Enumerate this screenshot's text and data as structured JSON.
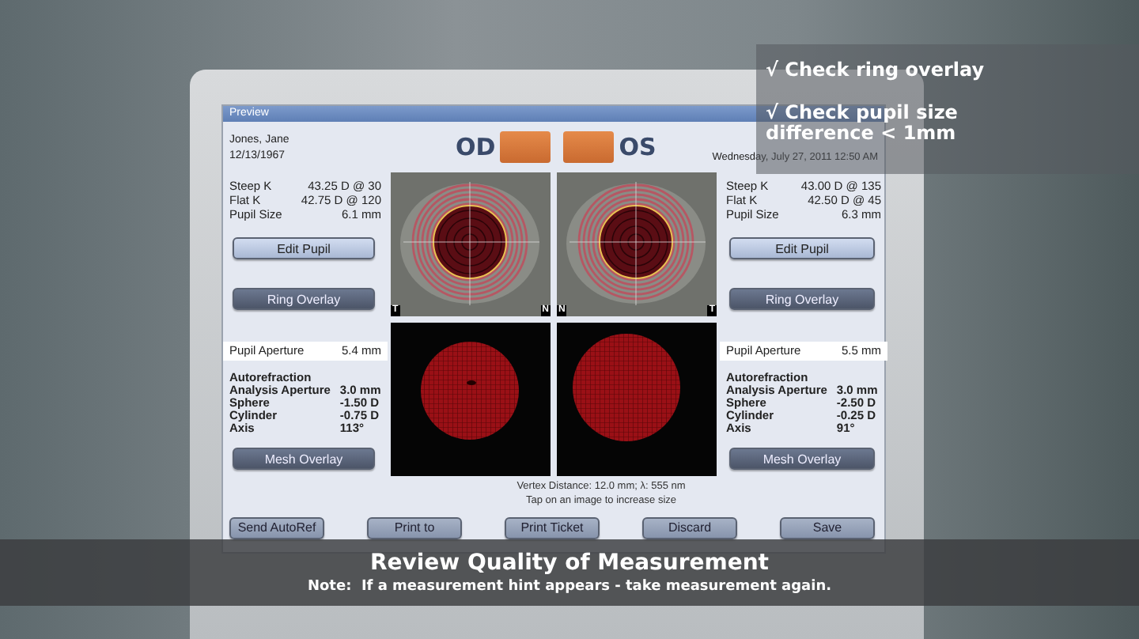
{
  "window": {
    "title": "Preview"
  },
  "patient": {
    "name": "Jones, Jane",
    "dob": "12/13/1967"
  },
  "eyes": [
    {
      "label": "OD"
    },
    {
      "label": "OS"
    }
  ],
  "date": "Wednesday, July 27, 2011 12:50 AM",
  "panels": [
    {
      "keratometry": [
        {
          "label": "Steep K",
          "value": "43.25 D @ 30"
        },
        {
          "label": "Flat K",
          "value": "42.75 D @ 120"
        },
        {
          "label": "Pupil Size",
          "value": "6.1 mm"
        }
      ],
      "buttons": [
        {
          "label": "Edit Pupil",
          "on": false
        },
        {
          "label": "Ring Overlay",
          "on": true
        }
      ],
      "aperture": {
        "label": "Pupil Aperture",
        "value": "5.4 mm"
      },
      "autorefraction": {
        "title": "Autorefraction",
        "rows": [
          {
            "label": "Analysis Aperture",
            "value": "3.0 mm"
          },
          {
            "label": "Sphere",
            "value": "-1.50 D"
          },
          {
            "label": "Cylinder",
            "value": "-0.75 D"
          },
          {
            "label": "Axis",
            "value": "113°"
          }
        ]
      },
      "mesh_button": {
        "label": "Mesh Overlay",
        "on": true
      }
    },
    {
      "keratometry": [
        {
          "label": "Steep K",
          "value": "43.00 D @ 135"
        },
        {
          "label": "Flat K",
          "value": "42.50 D @ 45"
        },
        {
          "label": "Pupil Size",
          "value": "6.3 mm"
        }
      ],
      "buttons": [
        {
          "label": "Edit Pupil",
          "on": false
        },
        {
          "label": "Ring Overlay",
          "on": true
        }
      ],
      "aperture": {
        "label": "Pupil Aperture",
        "value": "5.5 mm"
      },
      "autorefraction": {
        "title": "Autorefraction",
        "rows": [
          {
            "label": "Analysis Aperture",
            "value": "3.0 mm"
          },
          {
            "label": "Sphere",
            "value": "-2.50 D"
          },
          {
            "label": "Cylinder",
            "value": "-0.25 D"
          },
          {
            "label": "Axis",
            "value": "91°"
          }
        ]
      },
      "mesh_button": {
        "label": "Mesh Overlay",
        "on": true
      }
    }
  ],
  "topography": [
    {
      "corner_left": "T",
      "corner_right": "N"
    },
    {
      "corner_left": "N",
      "corner_right": "T"
    }
  ],
  "footer": {
    "vertex": "Vertex Distance: 12.0 mm; λ: 555 nm",
    "hint": "Tap on an image to increase size"
  },
  "actions": [
    "Send AutoRef",
    "Print to",
    "Print Ticket",
    "Discard",
    "Save"
  ],
  "checklist": [
    "√ Check ring overlay",
    "√ Check pupil size difference < 1mm"
  ],
  "caption": {
    "title": "Review Quality of Measurement",
    "note": "Note:  If a measurement hint appears - take measurement again."
  }
}
